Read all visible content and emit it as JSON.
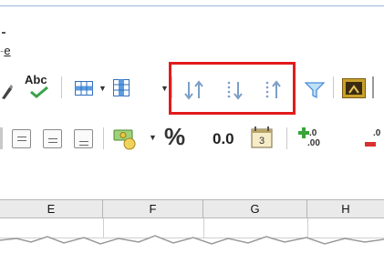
{
  "menu": {
    "fragment_underlined": "e"
  },
  "toolbar": {
    "spellcheck_label": "Abc",
    "percent_label": "%",
    "decimal_label": "0.0",
    "add_decimal_label": ".0",
    "add_decimal_sub": ".00",
    "remove_decimal_label": ".0",
    "dropdown_glyph": "▼"
  },
  "columns": [
    "E",
    "F",
    "G",
    "H"
  ],
  "colors": {
    "highlight": "#e21b1b",
    "sort_arrows": "#7c9ec7",
    "filter": "#4a8fd8"
  }
}
